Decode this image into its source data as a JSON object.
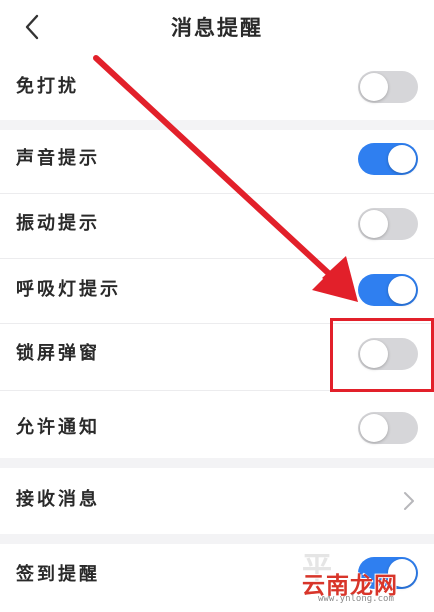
{
  "header": {
    "title": "消息提醒",
    "back_icon": "chevron-left-icon"
  },
  "rows": [
    {
      "label": "免打扰",
      "control": "toggle",
      "state": false
    },
    {
      "label": "声音提示",
      "control": "toggle",
      "state": true
    },
    {
      "label": "振动提示",
      "control": "toggle",
      "state": false
    },
    {
      "label": "呼吸灯提示",
      "control": "toggle",
      "state": true
    },
    {
      "label": "锁屏弹窗",
      "control": "toggle",
      "state": false
    },
    {
      "label": "允许通知",
      "control": "toggle",
      "state": false
    },
    {
      "label": "接收消息",
      "control": "chevron",
      "icon": "chevron-right-icon"
    },
    {
      "label": "签到提醒",
      "control": "toggle",
      "state": true
    }
  ],
  "annotations": {
    "arrow_color": "#e2202a",
    "highlight_color": "#e2202a",
    "highlight_target": "锁屏弹窗"
  },
  "watermark": {
    "text": "云南龙网",
    "sub": "www.ynlong.com"
  },
  "colors": {
    "toggle_on": "#2f7ff0",
    "toggle_off": "#d6d6d9",
    "section_gap": "#f3f3f5"
  }
}
